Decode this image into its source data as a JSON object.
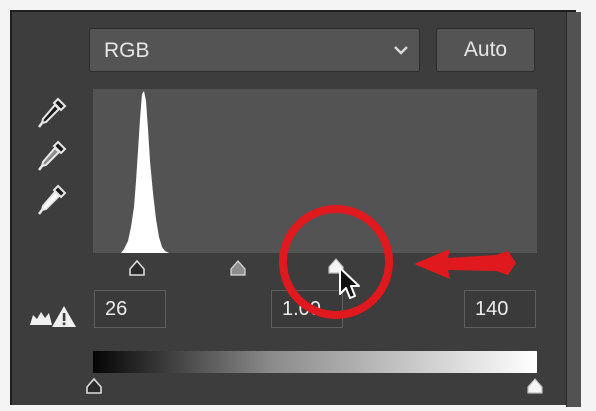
{
  "channel": {
    "selected": "RGB",
    "icon": "chevron-down-icon"
  },
  "auto_button": {
    "label": "Auto"
  },
  "eyedroppers": [
    {
      "name": "black-point-eyedropper",
      "icon": "eyedropper-icon"
    },
    {
      "name": "gray-point-eyedropper",
      "icon": "eyedropper-icon"
    },
    {
      "name": "white-point-eyedropper",
      "icon": "eyedropper-icon"
    }
  ],
  "input_levels": {
    "shadows": "26",
    "midtones": "1.00",
    "highlights": "140"
  },
  "output_levels": {
    "black_value": 0,
    "white_value": 255
  },
  "clipping_warning": {
    "icon": "clipping-warning-icon"
  },
  "annotation": {
    "color": "#e0191e",
    "circle_icon": "red-highlight-circle",
    "arrow_icon": "red-arrow-left-icon"
  },
  "colors": {
    "panel_bg": "#3d3d3d",
    "histogram_bg": "#535353",
    "histogram_fill": "#ffffff",
    "control_bg": "#545454",
    "text": "#e6e6e6"
  }
}
